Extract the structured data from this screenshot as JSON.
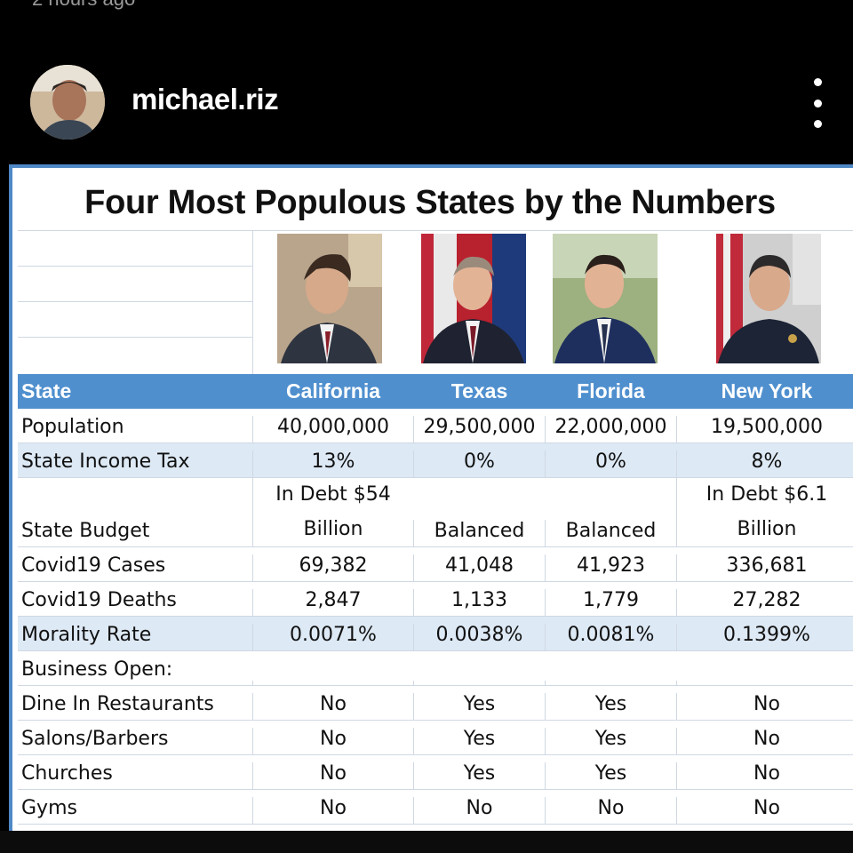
{
  "post": {
    "timestamp": "2 hours ago",
    "username": "michael.riz",
    "avatar_icon": "profile-photo",
    "more_icon": "vertical-ellipsis-icon"
  },
  "colors": {
    "accent": "#4f88c6",
    "header_row": "#4f8fce",
    "shaded_row": "#dde9f5"
  },
  "infographic": {
    "title": "Four Most Populous States by the Numbers",
    "header": {
      "label": "State",
      "states": [
        "California",
        "Texas",
        "Florida",
        "New York"
      ]
    },
    "rows": [
      {
        "label": "Population",
        "values": [
          "40,000,000",
          "29,500,000",
          "22,000,000",
          "19,500,000"
        ],
        "shade": false
      },
      {
        "label": "State Income Tax",
        "values": [
          "13%",
          "0%",
          "0%",
          "8%"
        ],
        "shade": true
      },
      {
        "label": "State Budget",
        "values": [
          "In Debt $54 Billion",
          "Balanced",
          "Balanced",
          "In Debt $6.1 Billion"
        ],
        "shade": false
      },
      {
        "label": "Covid19 Cases",
        "values": [
          "69,382",
          "41,048",
          "41,923",
          "336,681"
        ],
        "shade": false
      },
      {
        "label": "Covid19 Deaths",
        "values": [
          "2,847",
          "1,133",
          "1,779",
          "27,282"
        ],
        "shade": false
      },
      {
        "label": "Morality Rate",
        "values": [
          "0.0071%",
          "0.0038%",
          "0.0081%",
          "0.1399%"
        ],
        "shade": true
      },
      {
        "label": "Business Open:",
        "values": [
          "",
          "",
          "",
          ""
        ],
        "shade": false
      },
      {
        "label": "Dine In Restaurants",
        "values": [
          "No",
          "Yes",
          "Yes",
          "No"
        ],
        "shade": false
      },
      {
        "label": "Salons/Barbers",
        "values": [
          "No",
          "Yes",
          "Yes",
          "No"
        ],
        "shade": false
      },
      {
        "label": "Churches",
        "values": [
          "No",
          "Yes",
          "Yes",
          "No"
        ],
        "shade": false
      },
      {
        "label": "Gyms",
        "values": [
          "No",
          "No",
          "No",
          "No"
        ],
        "shade": false
      }
    ],
    "budget_split": {
      "california": [
        "In Debt $54",
        "Billion"
      ],
      "new_york": [
        "In Debt $6.1",
        "Billion"
      ]
    }
  }
}
